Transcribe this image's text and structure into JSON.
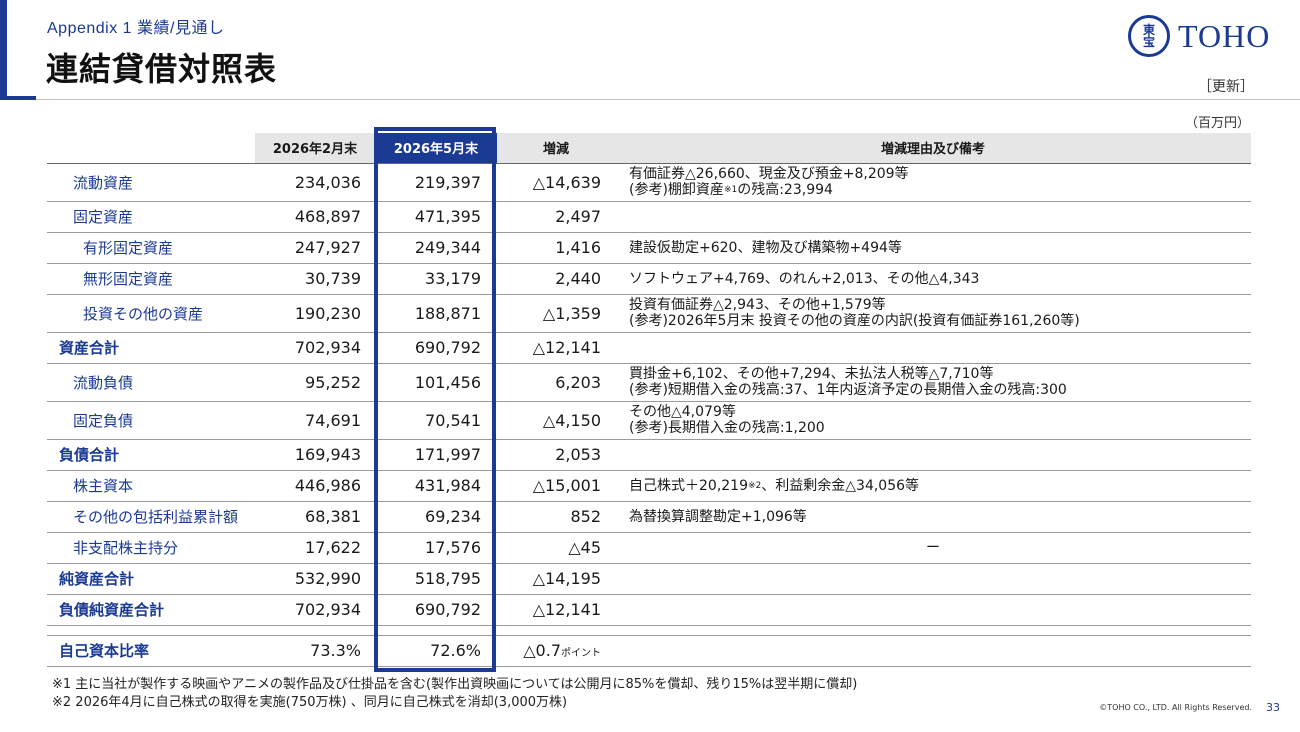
{
  "header": {
    "subtitle": "Appendix 1  業績/見通し",
    "title": "連結貸借対照表",
    "update_label": "［更新］",
    "unit_label": "（百万円）"
  },
  "logo": {
    "seal_chars": [
      "東",
      "宝"
    ],
    "wordmark": "TOHO"
  },
  "table": {
    "headers": [
      "",
      "2026年2月末",
      "2026年5月末",
      "増減",
      "増減理由及び備考"
    ],
    "rows": [
      {
        "label": "流動資産",
        "feb": "234,036",
        "may": "219,397",
        "diff": "△14,639",
        "note1": "有価証券△26,660、現金及び預金+8,209等",
        "note2a": "(参考)棚卸資産",
        "note2mark": "※1",
        "note2b": "の残高:23,994"
      },
      {
        "label": "固定資産",
        "feb": "468,897",
        "may": "471,395",
        "diff": "2,497",
        "note": ""
      },
      {
        "label": "有形固定資産",
        "feb": "247,927",
        "may": "249,344",
        "diff": "1,416",
        "note": "建設仮勘定+620、建物及び構築物+494等"
      },
      {
        "label": "無形固定資産",
        "feb": "30,739",
        "may": "33,179",
        "diff": "2,440",
        "note": "ソフトウェア+4,769、のれん+2,013、その他△4,343"
      },
      {
        "label": "投資その他の資産",
        "feb": "190,230",
        "may": "188,871",
        "diff": "△1,359",
        "note1": "投資有価証券△2,943、その他+1,579等",
        "note2": "(参考)2026年5月末 投資その他の資産の内訳(投資有価証券161,260等)"
      },
      {
        "label": "資産合計",
        "feb": "702,934",
        "may": "690,792",
        "diff": "△12,141",
        "note": ""
      },
      {
        "label": "流動負債",
        "feb": "95,252",
        "may": "101,456",
        "diff": "6,203",
        "note1": "買掛金+6,102、その他+7,294、未払法人税等△7,710等",
        "note2": "(参考)短期借入金の残高:37、1年内返済予定の長期借入金の残高:300"
      },
      {
        "label": "固定負債",
        "feb": "74,691",
        "may": "70,541",
        "diff": "△4,150",
        "note1": "その他△4,079等",
        "note2": "(参考)長期借入金の残高:1,200"
      },
      {
        "label": "負債合計",
        "feb": "169,943",
        "may": "171,997",
        "diff": "2,053",
        "note": ""
      },
      {
        "label": "株主資本",
        "feb": "446,986",
        "may": "431,984",
        "diff": "△15,001",
        "note_a": "自己株式＋20,219",
        "note_mark": "※2",
        "note_b": "、利益剰余金△34,056等"
      },
      {
        "label": "その他の包括利益累計額",
        "feb": "68,381",
        "may": "69,234",
        "diff": "852",
        "note": "為替換算調整勘定+1,096等"
      },
      {
        "label": "非支配株主持分",
        "feb": "17,622",
        "may": "17,576",
        "diff": "△45",
        "note": "ー"
      },
      {
        "label": "純資産合計",
        "feb": "532,990",
        "may": "518,795",
        "diff": "△14,195",
        "note": ""
      },
      {
        "label": "負債純資産合計",
        "feb": "702,934",
        "may": "690,792",
        "diff": "△12,141",
        "note": ""
      }
    ],
    "ratio": {
      "label": "自己資本比率",
      "feb": "73.3%",
      "may": "72.6%",
      "diff": "△0.7",
      "diff_unit": "ポイント"
    }
  },
  "footnotes": [
    "※1 主に当社が製作する映画やアニメの製作品及び仕掛品を含む(製作出資映画については公開月に85%を償却、残り15%は翌半期に償却)",
    "※2 2026年4月に自己株式の取得を実施(750万株) 、同月に自己株式を消却(3,000万株)"
  ],
  "footer": {
    "copyright": "©TOHO CO., LTD. All Rights Reserved.",
    "page_number": "33"
  },
  "colors": {
    "brand_blue": "#1b3a93",
    "header_gray": "#e6e6e6",
    "rule_gray": "#9a9a9a"
  }
}
